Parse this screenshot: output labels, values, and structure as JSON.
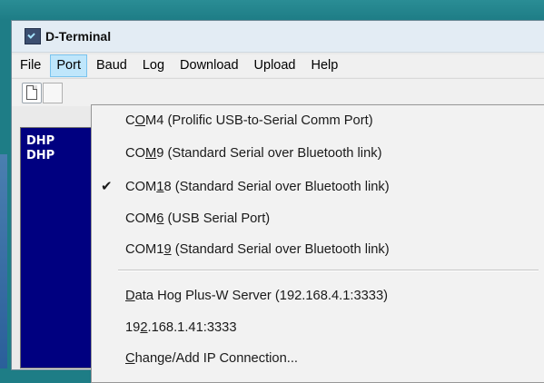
{
  "window": {
    "title": "D-Terminal"
  },
  "menubar": {
    "items": [
      "File",
      "Port",
      "Baud",
      "Log",
      "Download",
      "Upload",
      "Help"
    ]
  },
  "terminal": {
    "lines": [
      "DHP",
      "DHP"
    ]
  },
  "port_menu": {
    "items": [
      {
        "pre": "C",
        "mn": "O",
        "post": "M4 (Prolific USB-to-Serial Comm Port)",
        "checked": false
      },
      {
        "pre": "CO",
        "mn": "M",
        "post": "9 (Standard Serial over Bluetooth link)",
        "checked": false
      },
      {
        "pre": "COM",
        "mn": "1",
        "post": "8 (Standard Serial over Bluetooth link)",
        "checked": true
      },
      {
        "pre": "COM",
        "mn": "6",
        "post": " (USB Serial Port)",
        "checked": false
      },
      {
        "pre": "COM1",
        "mn": "9",
        "post": " (Standard Serial over Bluetooth link)",
        "checked": false
      }
    ],
    "check_icon": "✔",
    "network_items": [
      {
        "pre": "",
        "mn": "D",
        "post": "ata Hog Plus-W Server (192.168.4.1:3333)"
      },
      {
        "pre": "19",
        "mn": "2",
        "post": ".168.1.41:3333"
      },
      {
        "pre": "",
        "mn": "C",
        "post": "hange/Add IP Connection..."
      }
    ]
  },
  "icons": {
    "app": "terminal-app-icon",
    "new_file": "new-file-icon"
  },
  "colors": {
    "terminal_bg": "#000080",
    "menu_highlight": "#bfe6fb"
  }
}
